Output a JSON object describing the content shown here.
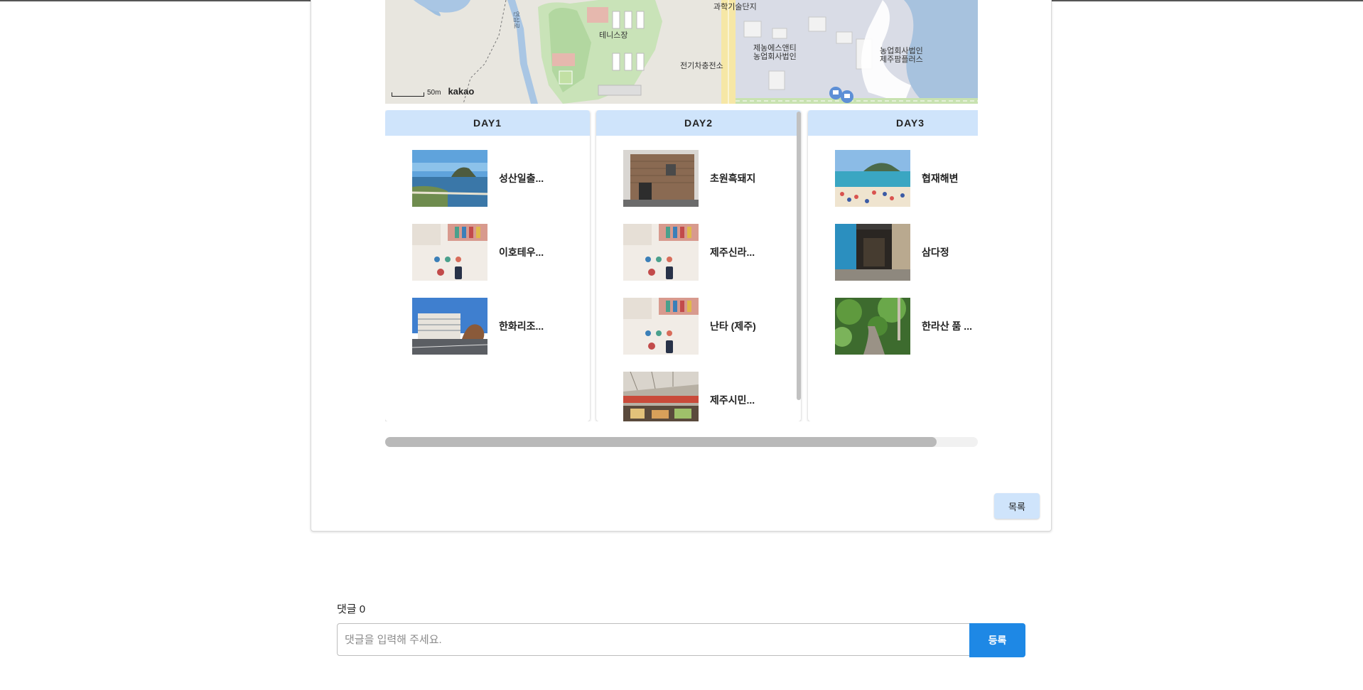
{
  "map": {
    "labels": {
      "area_top": "과학기술단지",
      "tennis": "테니스장",
      "charging": "전기차충전소",
      "company1_l1": "제농에스앤티",
      "company1_l2": "농업회사법인",
      "company2_l1": "농업회사법인",
      "company2_l2": "제주팜플러스",
      "road": "연삼로"
    },
    "scale_label": "50m",
    "brand": "kakao"
  },
  "days": [
    {
      "title": "DAY1",
      "places": [
        {
          "name": "성산일출...",
          "image": "coast-photo"
        },
        {
          "name": "이호테우...",
          "image": "placeholder-photo"
        },
        {
          "name": "한화리조...",
          "image": "resort-photo"
        }
      ]
    },
    {
      "title": "DAY2",
      "places": [
        {
          "name": "초원흑돼지",
          "image": "brick-building-photo"
        },
        {
          "name": "제주신라...",
          "image": "placeholder-photo"
        },
        {
          "name": "난타 (제주)",
          "image": "placeholder-photo"
        },
        {
          "name": "제주시민...",
          "image": "market-photo"
        }
      ]
    },
    {
      "title": "DAY3",
      "places": [
        {
          "name": "협재해변",
          "image": "beach-photo"
        },
        {
          "name": "삼다정",
          "image": "lobby-photo"
        },
        {
          "name": "한라산 품 ...",
          "image": "forest-path-photo"
        }
      ]
    }
  ],
  "actions": {
    "list_label": "목록"
  },
  "comments": {
    "count_label": "댓글 0",
    "placeholder": "댓글을 입력해 주세요.",
    "submit_label": "등록"
  },
  "colors": {
    "day_header": "#cfe4fb",
    "primary": "#1e88e5"
  }
}
